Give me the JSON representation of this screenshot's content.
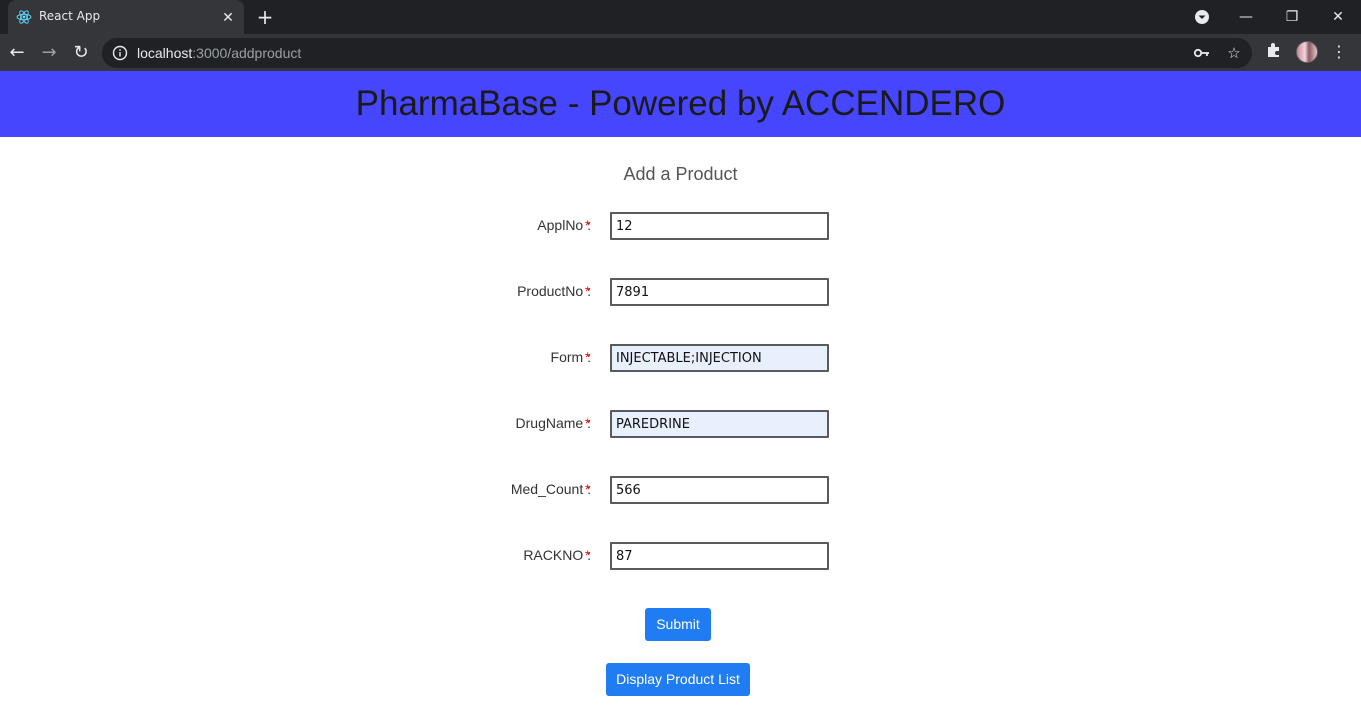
{
  "browser": {
    "tab_title": "React App",
    "tab_close": "✕",
    "new_tab": "+",
    "url_host": "localhost",
    "url_path": ":3000/addproduct",
    "window_minimize": "—",
    "window_restore": "❐",
    "window_close": "✕",
    "back": "←",
    "forward": "→",
    "reload": "↻"
  },
  "header": {
    "title": "PharmaBase - Powered by ACCENDERO",
    "background": "#4646ff"
  },
  "form": {
    "title": "Add a Product",
    "required_marker": "*",
    "fields": [
      {
        "label": "ApplNo :",
        "value": "12"
      },
      {
        "label": "ProductNo :",
        "value": "7891"
      },
      {
        "label": "Form :",
        "value": "INJECTABLE;INJECTION"
      },
      {
        "label": "DrugName :",
        "value": "PAREDRINE"
      },
      {
        "label": "Med_Count :",
        "value": "566"
      },
      {
        "label": "RACKNO :",
        "value": "87"
      }
    ],
    "submit_label": "Submit",
    "display_list_label": "Display Product List"
  },
  "colors": {
    "button": "#1f7cf2",
    "required": "#ee0000",
    "autofill": "#e8f0fe"
  }
}
